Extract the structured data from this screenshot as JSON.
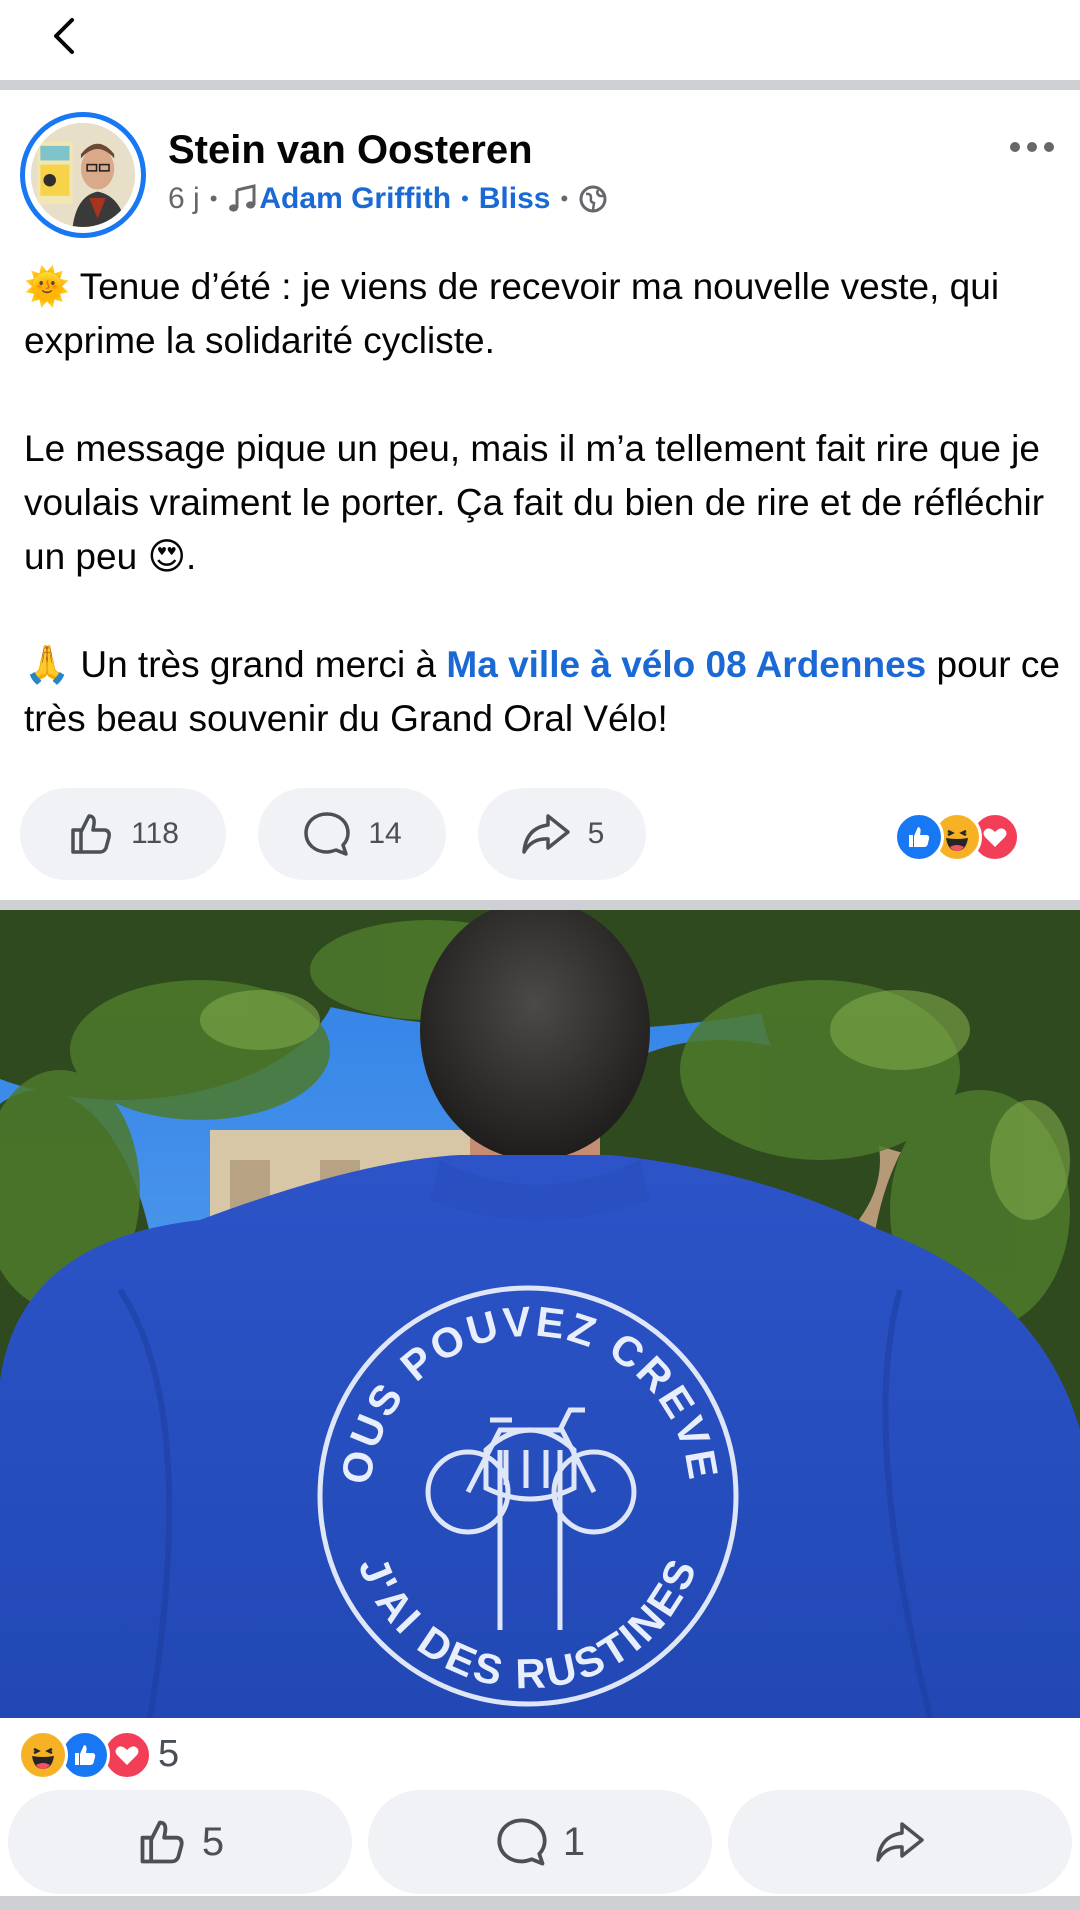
{
  "nav": {
    "back_icon": "chevron-left-icon"
  },
  "post": {
    "author": "Stein van Oosteren",
    "time": "6 j",
    "music_icon": "music-note-icon",
    "song_artist": "Adam Griffith",
    "song_title": "Bliss",
    "privacy_icon": "globe-icon",
    "paragraphs": [
      {
        "emoji": "🌞",
        "text": " Tenue d’été : je viens de recevoir ma nouvelle veste, qui exprime la solidarité cycliste."
      },
      {
        "text_before": "Le message pique un peu, mais il m’a tellement fait rire que je voulais vraiment le porter. Ça fait du bien de rire et de réfléchir un peu ",
        "emoji": "😍",
        "text_after": "."
      },
      {
        "emoji": "🙏",
        "text_before": " Un très grand merci à ",
        "mention": "Ma ville à vélo 08 Ardennes",
        "text_after": " pour ce très beau souvenir du Grand Oral Vélo!"
      }
    ],
    "actions": {
      "like_count": "118",
      "comment_count": "14",
      "share_count": "5"
    },
    "reaction_icons": [
      "like",
      "haha",
      "love"
    ]
  },
  "photo": {
    "jacket_text_top": "VOUS POUVEZ CREVER",
    "jacket_text_bottom": "J'AI DES RUSTINES"
  },
  "photo_post": {
    "reaction_icons": [
      "haha",
      "like",
      "love"
    ],
    "reaction_count": "5",
    "like_count": "5",
    "comment_count": "1"
  },
  "colors": {
    "accent": "#1877f2",
    "link": "#1a69d4",
    "jacket": "#2f59cf",
    "love": "#f33e58",
    "haha": "#f7b125"
  }
}
